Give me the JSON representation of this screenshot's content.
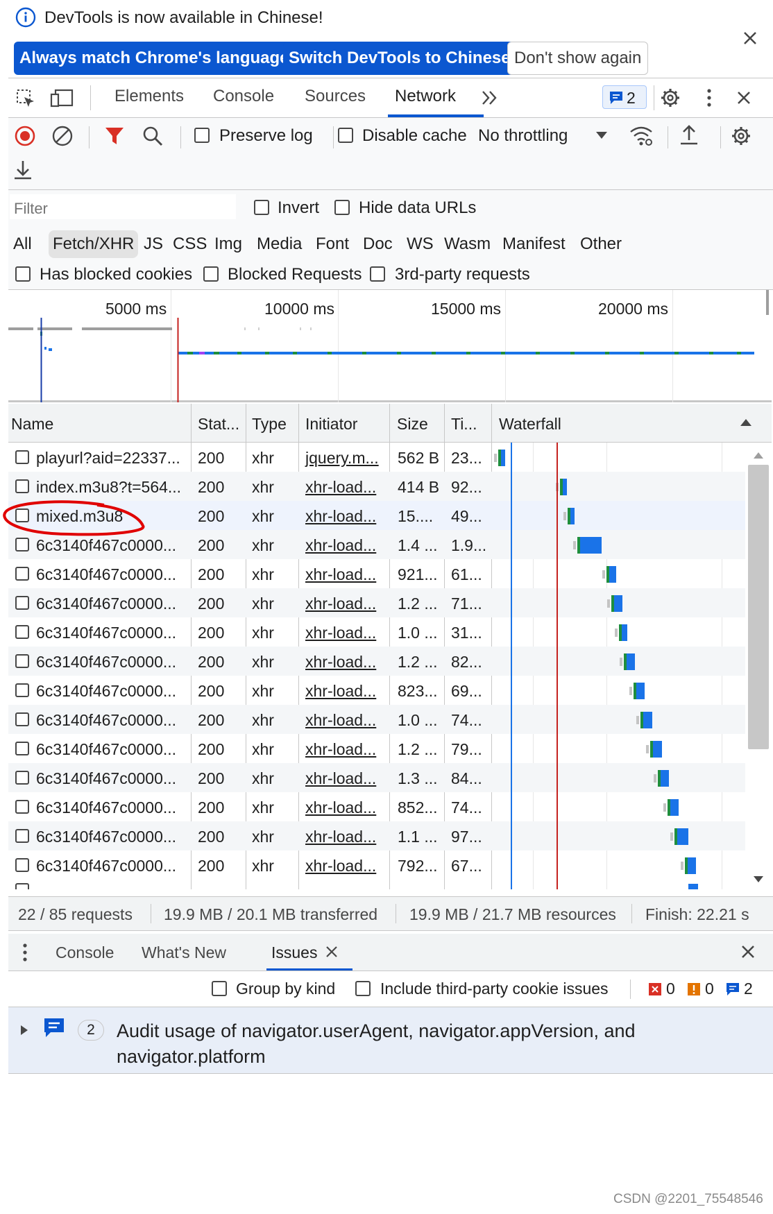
{
  "infobar": {
    "message": "DevTools is now available in Chinese!",
    "btn_match": "Always match Chrome's language",
    "btn_switch": "Switch DevTools to Chinese",
    "btn_dont": "Don't show again"
  },
  "tabs": {
    "elements": "Elements",
    "console": "Console",
    "sources": "Sources",
    "network": "Network",
    "issues_count": "2"
  },
  "toolbar": {
    "preserve_log": "Preserve log",
    "disable_cache": "Disable cache",
    "throttling": "No throttling"
  },
  "filter": {
    "placeholder": "Filter",
    "invert": "Invert",
    "hide_data_urls": "Hide data URLs",
    "types": [
      "All",
      "Fetch/XHR",
      "JS",
      "CSS",
      "Img",
      "Media",
      "Font",
      "Doc",
      "WS",
      "Wasm",
      "Manifest",
      "Other"
    ],
    "selected_type": "Fetch/XHR",
    "has_blocked_cookies": "Has blocked cookies",
    "blocked_requests": "Blocked Requests",
    "third_party": "3rd-party requests"
  },
  "overview": {
    "ticks": [
      "5000 ms",
      "10000 ms",
      "15000 ms",
      "20000 ms"
    ]
  },
  "table": {
    "headers": {
      "name": "Name",
      "status": "Stat...",
      "type": "Type",
      "initiator": "Initiator",
      "size": "Size",
      "time": "Ti...",
      "waterfall": "Waterfall"
    },
    "rows": [
      {
        "name": "playurl?aid=22337...",
        "status": "200",
        "type": "xhr",
        "initiator": "jquery.m...",
        "size": "562 B",
        "time": "23...",
        "wf_start": 0.016,
        "wf_len": 0.01
      },
      {
        "name": "index.m3u8?t=564...",
        "status": "200",
        "type": "xhr",
        "initiator": "xhr-load...",
        "size": "414 B",
        "time": "92...",
        "wf_start": 0.27,
        "wf_len": 0.012
      },
      {
        "name": "mixed.m3u8",
        "status": "200",
        "type": "xhr",
        "initiator": "xhr-load...",
        "size": "15....",
        "time": "49...",
        "wf_start": 0.3,
        "wf_len": 0.012
      },
      {
        "name": "6c3140f467c0000...",
        "status": "200",
        "type": "xhr",
        "initiator": "xhr-load...",
        "size": "1.4 ...",
        "time": "1.9...",
        "wf_start": 0.34,
        "wf_len": 0.09
      },
      {
        "name": "6c3140f467c0000...",
        "status": "200",
        "type": "xhr",
        "initiator": "xhr-load...",
        "size": "921...",
        "time": "61...",
        "wf_start": 0.46,
        "wf_len": 0.03
      },
      {
        "name": "6c3140f467c0000...",
        "status": "200",
        "type": "xhr",
        "initiator": "xhr-load...",
        "size": "1.2 ...",
        "time": "71...",
        "wf_start": 0.48,
        "wf_len": 0.035
      },
      {
        "name": "6c3140f467c0000...",
        "status": "200",
        "type": "xhr",
        "initiator": "xhr-load...",
        "size": "1.0 ...",
        "time": "31...",
        "wf_start": 0.51,
        "wf_len": 0.025
      },
      {
        "name": "6c3140f467c0000...",
        "status": "200",
        "type": "xhr",
        "initiator": "xhr-load...",
        "size": "1.2 ...",
        "time": "82...",
        "wf_start": 0.53,
        "wf_len": 0.035
      },
      {
        "name": "6c3140f467c0000...",
        "status": "200",
        "type": "xhr",
        "initiator": "xhr-load...",
        "size": "823...",
        "time": "69...",
        "wf_start": 0.57,
        "wf_len": 0.035
      },
      {
        "name": "6c3140f467c0000...",
        "status": "200",
        "type": "xhr",
        "initiator": "xhr-load...",
        "size": "1.0 ...",
        "time": "74...",
        "wf_start": 0.6,
        "wf_len": 0.035
      },
      {
        "name": "6c3140f467c0000...",
        "status": "200",
        "type": "xhr",
        "initiator": "xhr-load...",
        "size": "1.2 ...",
        "time": "79...",
        "wf_start": 0.64,
        "wf_len": 0.035
      },
      {
        "name": "6c3140f467c0000...",
        "status": "200",
        "type": "xhr",
        "initiator": "xhr-load...",
        "size": "1.3 ...",
        "time": "84...",
        "wf_start": 0.67,
        "wf_len": 0.035
      },
      {
        "name": "6c3140f467c0000...",
        "status": "200",
        "type": "xhr",
        "initiator": "xhr-load...",
        "size": "852...",
        "time": "74...",
        "wf_start": 0.71,
        "wf_len": 0.035
      },
      {
        "name": "6c3140f467c0000...",
        "status": "200",
        "type": "xhr",
        "initiator": "xhr-load...",
        "size": "1.1 ...",
        "time": "97...",
        "wf_start": 0.74,
        "wf_len": 0.045
      },
      {
        "name": "6c3140f467c0000...",
        "status": "200",
        "type": "xhr",
        "initiator": "xhr-load...",
        "size": "792...",
        "time": "67...",
        "wf_start": 0.78,
        "wf_len": 0.035
      }
    ]
  },
  "status": {
    "requests": "22 / 85 requests",
    "transferred": "19.9 MB / 20.1 MB transferred",
    "resources": "19.9 MB / 21.7 MB resources",
    "finish": "Finish: 22.21 s"
  },
  "drawer": {
    "console": "Console",
    "whats_new": "What's New",
    "issues": "Issues",
    "group_by_kind": "Group by kind",
    "include_third_party": "Include third-party cookie issues",
    "error_count": "0",
    "warning_count": "0",
    "info_count": "2",
    "issue_count": "2",
    "issue_text": "Audit usage of navigator.userAgent, navigator.appVersion, and navigator.platform"
  },
  "watermark": "CSDN @2201_75548546",
  "colors": {
    "accent": "#0b57d0",
    "waterfall_bar": "#1a73e8",
    "dom_line": "#1a73e8",
    "load_line": "#c5221f",
    "annotation": "#e00000"
  }
}
